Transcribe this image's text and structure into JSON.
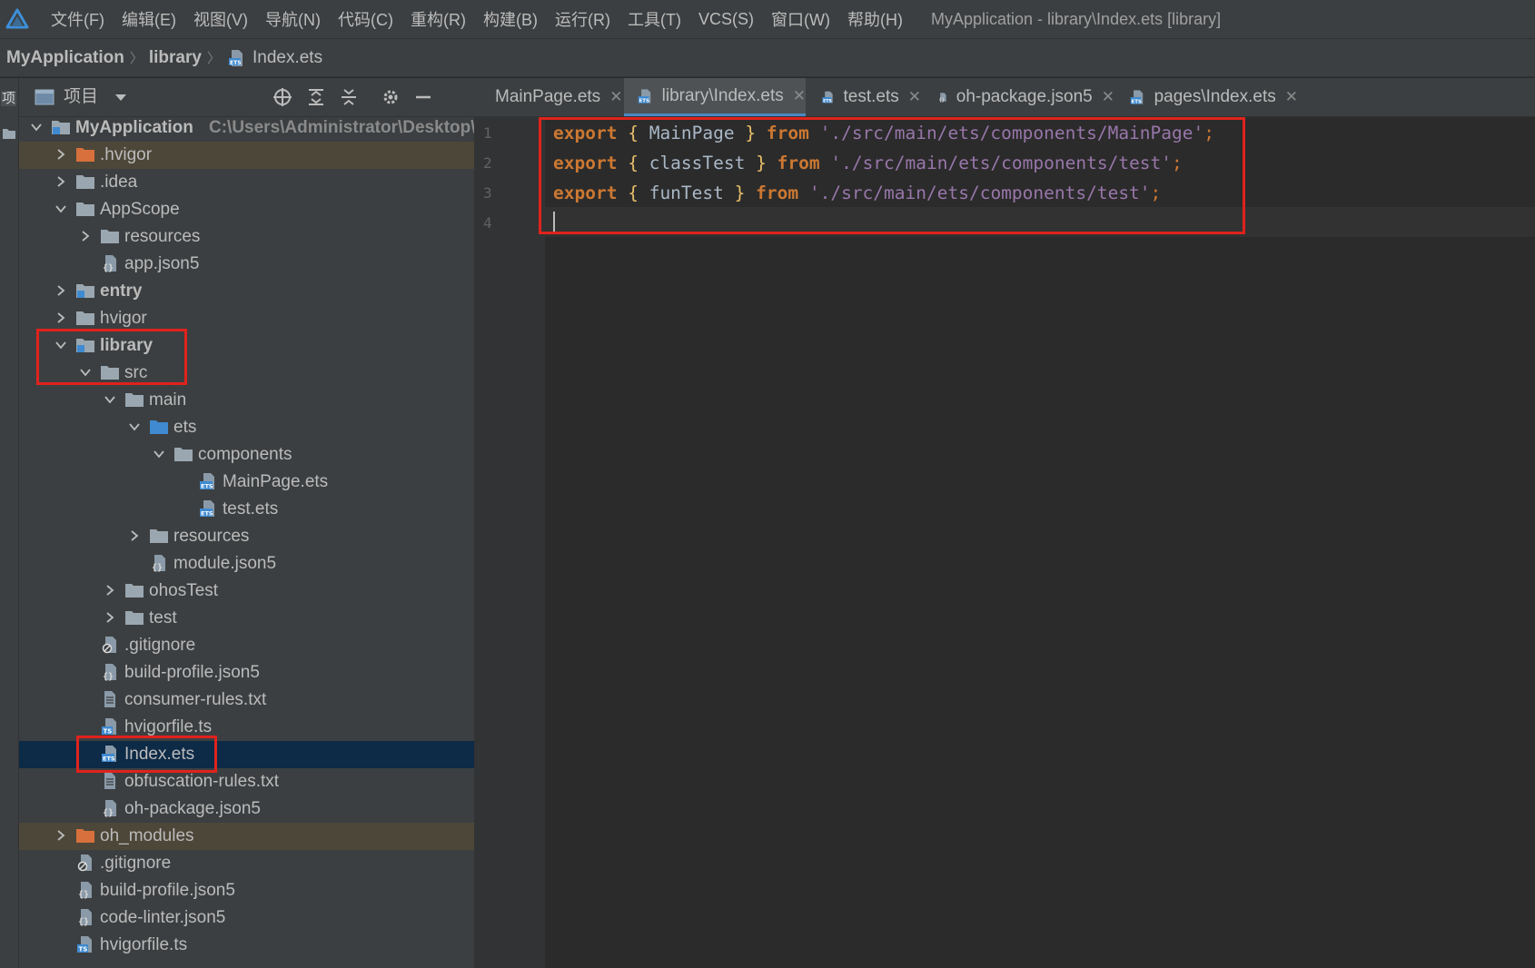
{
  "menubar": {
    "items": [
      "文件(F)",
      "编辑(E)",
      "视图(V)",
      "导航(N)",
      "代码(C)",
      "重构(R)",
      "构建(B)",
      "运行(R)",
      "工具(T)",
      "VCS(S)",
      "窗口(W)",
      "帮助(H)"
    ],
    "window_title": "MyApplication - library\\Index.ets [library]"
  },
  "breadcrumb": [
    "MyApplication",
    "library",
    "Index.ets"
  ],
  "tool_strip": {
    "label": "项目"
  },
  "project_panel": {
    "title": "项目",
    "tree": [
      {
        "label": "MyApplication",
        "path": "C:\\Users\\Administrator\\Desktop\\H",
        "depth": 0,
        "expanded": true,
        "icon": "module-folder-icon",
        "bold": true
      },
      {
        "label": ".hvigor",
        "depth": 1,
        "expanded": false,
        "icon": "excluded-folder-icon",
        "highlight": true
      },
      {
        "label": ".idea",
        "depth": 1,
        "expanded": false,
        "icon": "folder-icon"
      },
      {
        "label": "AppScope",
        "depth": 1,
        "expanded": true,
        "icon": "folder-icon"
      },
      {
        "label": "resources",
        "depth": 2,
        "expanded": false,
        "icon": "folder-icon"
      },
      {
        "label": "app.json5",
        "depth": 2,
        "icon": "json-file-icon"
      },
      {
        "label": "entry",
        "depth": 1,
        "expanded": false,
        "icon": "module-folder-icon",
        "bold": true
      },
      {
        "label": "hvigor",
        "depth": 1,
        "expanded": false,
        "icon": "folder-icon"
      },
      {
        "label": "library",
        "depth": 1,
        "expanded": true,
        "icon": "module-folder-icon",
        "bold": true
      },
      {
        "label": "src",
        "depth": 2,
        "expanded": true,
        "icon": "folder-icon"
      },
      {
        "label": "main",
        "depth": 3,
        "expanded": true,
        "icon": "folder-icon"
      },
      {
        "label": "ets",
        "depth": 4,
        "expanded": true,
        "icon": "source-folder-icon"
      },
      {
        "label": "components",
        "depth": 5,
        "expanded": true,
        "icon": "folder-icon"
      },
      {
        "label": "MainPage.ets",
        "depth": 6,
        "icon": "ets-file-icon"
      },
      {
        "label": "test.ets",
        "depth": 6,
        "icon": "ets-file-icon"
      },
      {
        "label": "resources",
        "depth": 4,
        "expanded": false,
        "icon": "folder-icon"
      },
      {
        "label": "module.json5",
        "depth": 4,
        "icon": "json-file-icon"
      },
      {
        "label": "ohosTest",
        "depth": 3,
        "expanded": false,
        "icon": "folder-icon"
      },
      {
        "label": "test",
        "depth": 3,
        "expanded": false,
        "icon": "folder-icon"
      },
      {
        "label": ".gitignore",
        "depth": 2,
        "icon": "gitignore-file-icon"
      },
      {
        "label": "build-profile.json5",
        "depth": 2,
        "icon": "json-file-icon"
      },
      {
        "label": "consumer-rules.txt",
        "depth": 2,
        "icon": "text-file-icon"
      },
      {
        "label": "hvigorfile.ts",
        "depth": 2,
        "icon": "ts-file-icon"
      },
      {
        "label": "Index.ets",
        "depth": 2,
        "icon": "ets-file-icon",
        "selected": true
      },
      {
        "label": "obfuscation-rules.txt",
        "depth": 2,
        "icon": "text-file-icon"
      },
      {
        "label": "oh-package.json5",
        "depth": 2,
        "icon": "json-file-icon"
      },
      {
        "label": "oh_modules",
        "depth": 1,
        "expanded": false,
        "icon": "excluded-folder-icon",
        "highlight": true
      },
      {
        "label": ".gitignore",
        "depth": 1,
        "icon": "gitignore-file-icon"
      },
      {
        "label": "build-profile.json5",
        "depth": 1,
        "icon": "json-file-icon"
      },
      {
        "label": "code-linter.json5",
        "depth": 1,
        "icon": "json-file-icon"
      },
      {
        "label": "hvigorfile.ts",
        "depth": 1,
        "icon": "ts-file-icon"
      }
    ]
  },
  "tabs": [
    {
      "label": "MainPage.ets",
      "icon": "ets-file-icon"
    },
    {
      "label": "library\\Index.ets",
      "icon": "ets-file-icon",
      "active": true
    },
    {
      "label": "test.ets",
      "icon": "ets-file-icon"
    },
    {
      "label": "oh-package.json5",
      "icon": "json-file-icon"
    },
    {
      "label": "pages\\Index.ets",
      "icon": "ets-file-icon"
    }
  ],
  "editor": {
    "line_numbers": [
      "1",
      "2",
      "3",
      "4"
    ],
    "lines": [
      {
        "kw": "export",
        "open": "{",
        "name": "MainPage",
        "close": "}",
        "from": "from",
        "path": "'./src/main/ets/components/MainPage'",
        "semi": ";"
      },
      {
        "kw": "export",
        "open": "{",
        "name": "classTest",
        "close": "}",
        "from": "from",
        "path": "'./src/main/ets/components/test'",
        "semi": ";"
      },
      {
        "kw": "export",
        "open": "{",
        "name": "funTest",
        "close": "}",
        "from": "from",
        "path": "'./src/main/ets/components/test'",
        "semi": ";"
      }
    ]
  },
  "colors": {
    "keyword": "#cc7832",
    "string": "#9876aa",
    "brace": "#e8bf6a",
    "annotation": "#e0221c",
    "selection": "#0d2a47"
  }
}
